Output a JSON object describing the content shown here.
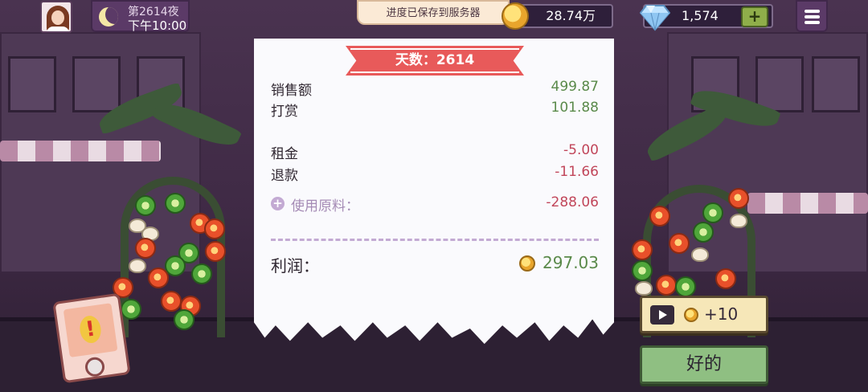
{
  "top_bar": {
    "night_label": "第2614夜",
    "time_label": "下午10:00",
    "toast": "进度已保存到服务器",
    "coins": "28.74万",
    "gems": "1,574",
    "add_gems_label": "+"
  },
  "receipt": {
    "day_banner": "天数：2614",
    "sales_label": "销售额",
    "sales_value": "499.87",
    "tips_label": "打赏",
    "tips_value": "101.88",
    "rent_label": "租金",
    "rent_value": "-5.00",
    "refund_label": "退款",
    "refund_value": "-11.66",
    "ingredients_label": "使用原料：",
    "ingredients_value": "-288.06",
    "profit_label": "利润：",
    "profit_value": "297.03"
  },
  "actions": {
    "ad_reward_label": "+10",
    "ok_label": "好的"
  },
  "colors": {
    "positive": "#5a8a4a",
    "negative": "#c1465a",
    "banner": "#e85a5a"
  }
}
